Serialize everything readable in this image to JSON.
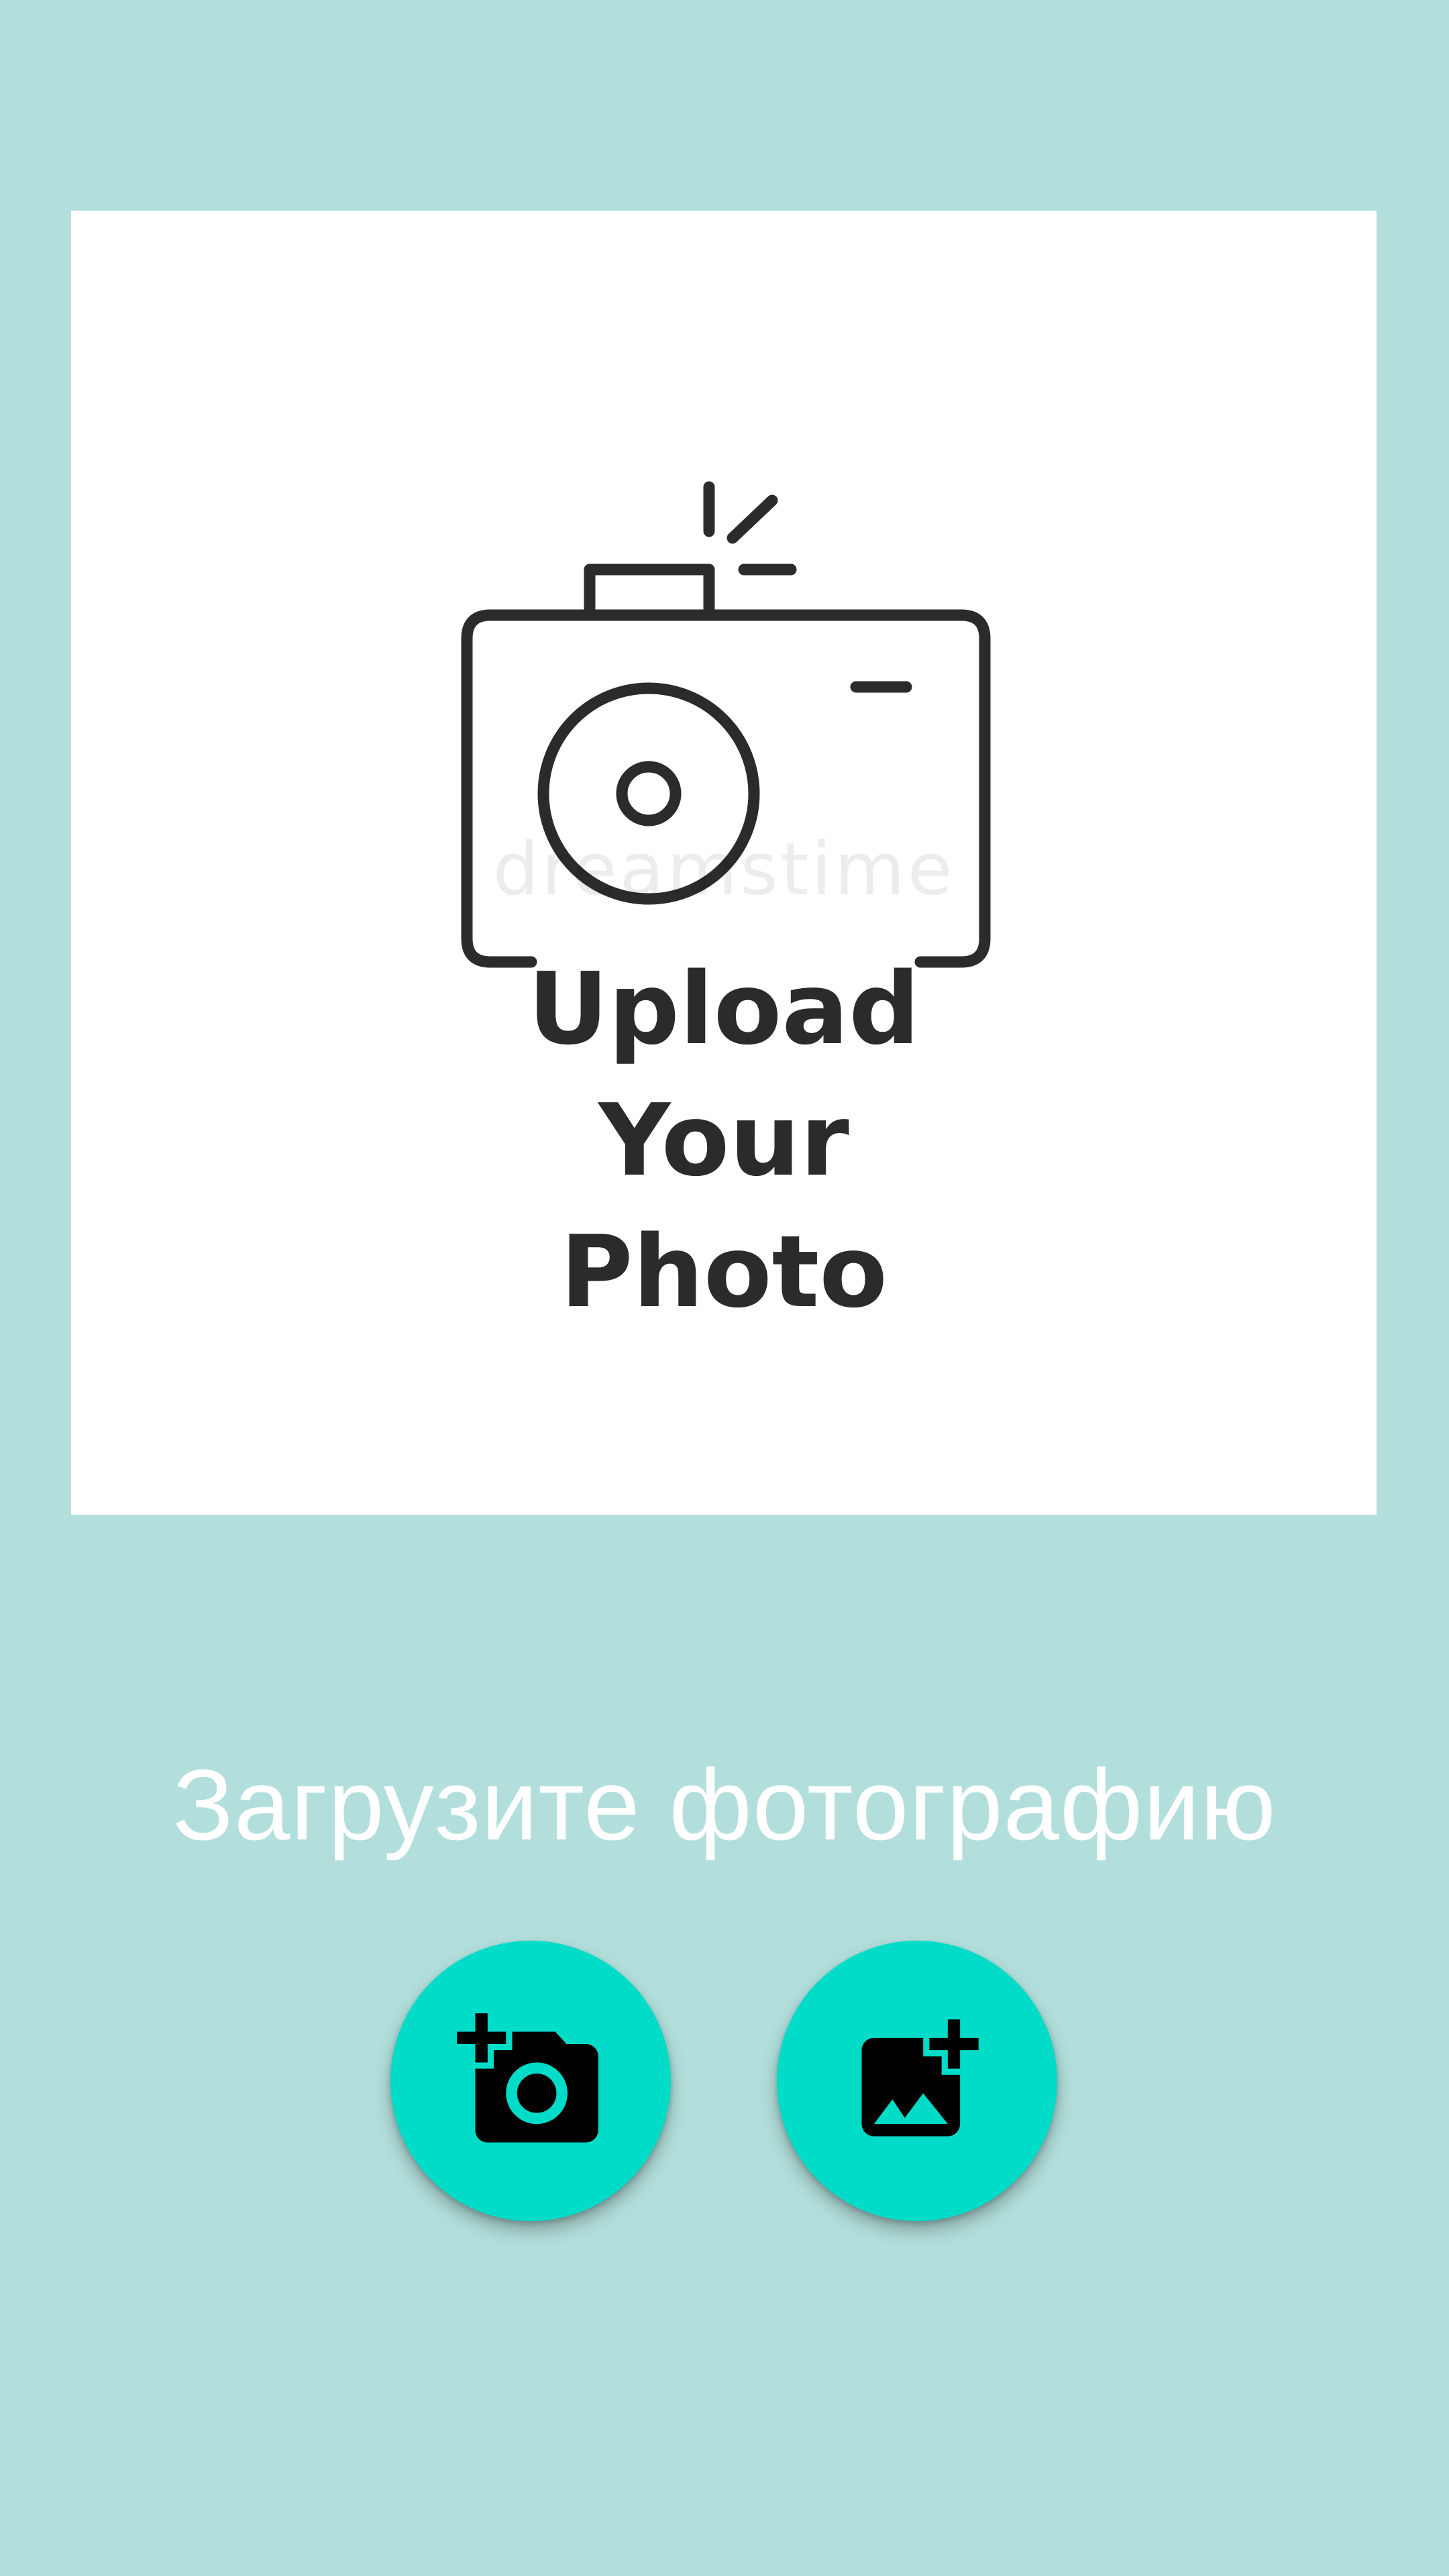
{
  "colors": {
    "background": "#b2dfdc",
    "card": "#ffffff",
    "art_stroke": "#2b2b2b",
    "prompt_text": "#ffffff",
    "fab": "#00dcc8",
    "fab_icon": "#000000",
    "watermark": "#000000"
  },
  "preview": {
    "upload_lines": [
      "Upload",
      "Your",
      "Photo"
    ],
    "watermark": "dreamstime"
  },
  "prompt": {
    "text": "Загрузите фотографию"
  },
  "actions": {
    "camera_icon": "add-a-photo-icon",
    "gallery_icon": "add-photo-alternate-icon"
  }
}
